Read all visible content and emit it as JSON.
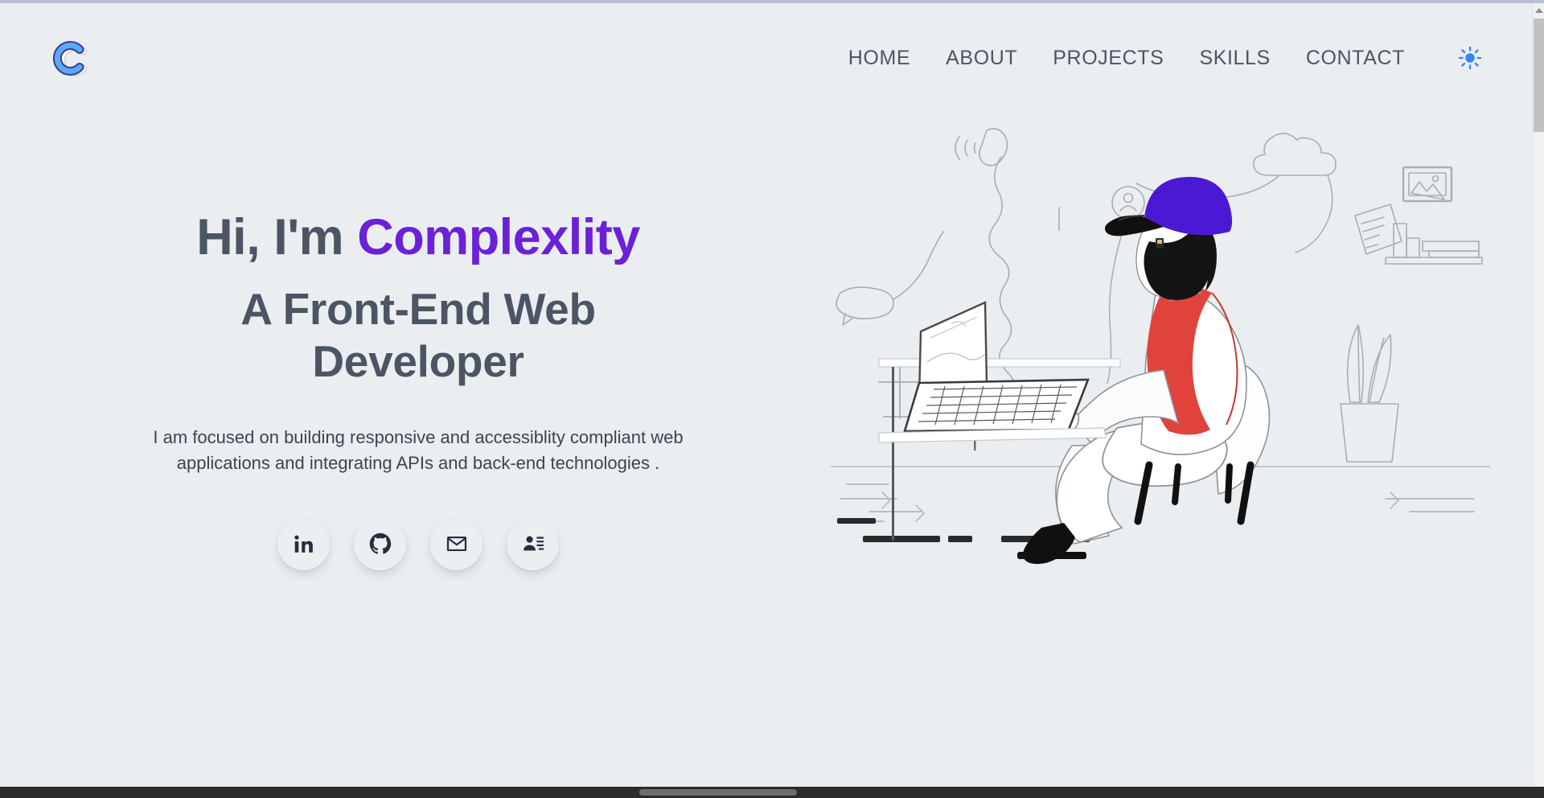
{
  "site": {
    "logo_letter": "C",
    "logo_color": "#5aa9f8",
    "logo_outline_color": "#3b3b8f",
    "background_color": "#eaeef1"
  },
  "nav": {
    "items": [
      {
        "label": "HOME",
        "name": "nav-link-home"
      },
      {
        "label": "ABOUT",
        "name": "nav-link-about"
      },
      {
        "label": "PROJECTS",
        "name": "nav-link-projects"
      },
      {
        "label": "SKILLS",
        "name": "nav-link-skills"
      },
      {
        "label": "CONTACT",
        "name": "nav-link-contact"
      }
    ],
    "link_color": "#4b5563",
    "theme_toggle": {
      "icon": "sun-icon",
      "color": "#3b82f6",
      "title": "Toggle light / dark theme"
    }
  },
  "hero": {
    "greeting": "Hi, I'm ",
    "name": "Complexlity",
    "name_color": "#6b21d6",
    "subtitle": "A Front-End Web Developer",
    "description": "I am focused on building responsive and accessiblity compliant web applications and integrating APIs and back-end technologies .",
    "heading_color": "#4b5563",
    "socials": [
      {
        "label": "LinkedIn",
        "icon": "linkedin-icon",
        "name": "social-link-linkedin"
      },
      {
        "label": "GitHub",
        "icon": "github-icon",
        "name": "social-link-github"
      },
      {
        "label": "Email",
        "icon": "mail-icon",
        "name": "social-link-email"
      },
      {
        "label": "Resume",
        "icon": "contact-card-icon",
        "name": "social-link-resume"
      }
    ],
    "illustration": {
      "name": "developer-at-laptop-illustration",
      "alt": "Illustration of a bearded developer in a purple cap and red vest typing on a laptop while seated in a white chair, surrounded by light sketched icons",
      "cap_color": "#4b19d4",
      "vest_color": "#e0433c",
      "beard_color": "#141414",
      "sketch_color": "#9aa2ab"
    }
  },
  "scrollbars": {
    "vertical": {
      "name": "vertical-scrollbar",
      "thumb_color": "#c1c1c1",
      "track_color": "#f1f1f1"
    },
    "horizontal": {
      "name": "horizontal-scrollbar",
      "thumb_color": "#6d6d6d",
      "track_color": "#2b2b2b"
    }
  }
}
